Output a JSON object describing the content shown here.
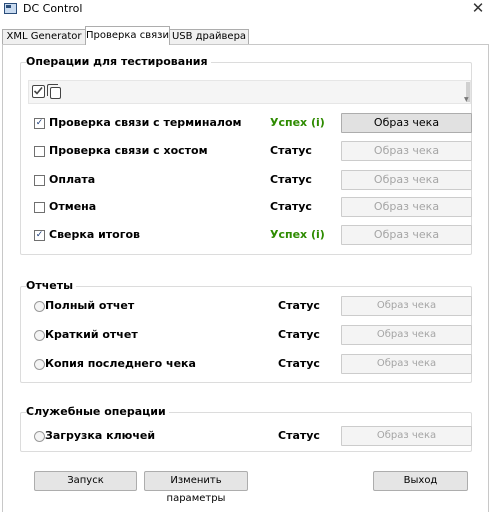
{
  "window": {
    "title": "DC Control",
    "close_glyph": "✕"
  },
  "tabs": [
    {
      "label": "XML Generator",
      "active": false
    },
    {
      "label": "Проверка связи",
      "active": true
    },
    {
      "label": "USB драйвера",
      "active": false
    }
  ],
  "testing": {
    "title": "Операции для тестирования",
    "toolbar_icons": [
      "checkbox-checked-icon",
      "copy-icon"
    ],
    "rows": [
      {
        "label": "Проверка связи с терминалом",
        "checked": true,
        "status": "Успех (i)",
        "status_color": "#2e8b00",
        "button": "Образ чека",
        "button_enabled": true
      },
      {
        "label": "Проверка связи с хостом",
        "checked": false,
        "status": "Статус",
        "status_color": "#000000",
        "button": "Образ чека",
        "button_enabled": false
      },
      {
        "label": "Оплата",
        "checked": false,
        "status": "Статус",
        "status_color": "#000000",
        "button": "Образ чека",
        "button_enabled": false
      },
      {
        "label": "Отмена",
        "checked": false,
        "status": "Статус",
        "status_color": "#000000",
        "button": "Образ чека",
        "button_enabled": false
      },
      {
        "label": "Сверка итогов",
        "checked": true,
        "status": "Успех (i)",
        "status_color": "#2e8b00",
        "button": "Образ чека",
        "button_enabled": false
      }
    ]
  },
  "reports": {
    "title": "Отчеты",
    "rows": [
      {
        "label": "Полный отчет",
        "status": "Статус",
        "button": "Образ чека"
      },
      {
        "label": "Краткий отчет",
        "status": "Статус",
        "button": "Образ чека"
      },
      {
        "label": "Копия последнего чека",
        "status": "Статус",
        "button": "Образ чека"
      }
    ]
  },
  "service": {
    "title": "Служебные операции",
    "rows": [
      {
        "label": "Загрузка ключей",
        "status": "Статус",
        "button": "Образ чека"
      }
    ]
  },
  "footer": {
    "run_label": "Запуск",
    "params_label": "Изменить параметры",
    "exit_label": "Выход"
  },
  "colors": {
    "success": "#2e8b00",
    "disabled_text": "#a5a5a5"
  }
}
